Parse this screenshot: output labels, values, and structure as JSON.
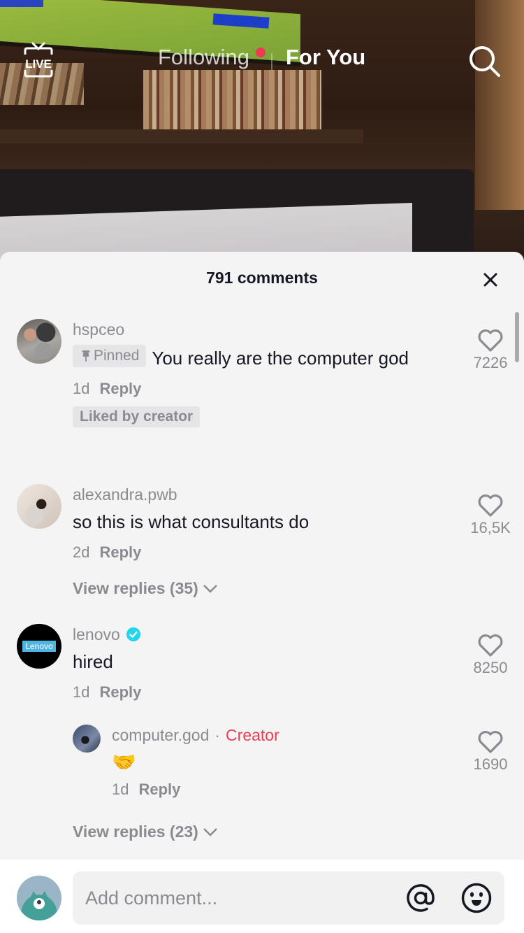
{
  "top_nav": {
    "live_label": "LIVE",
    "tabs": [
      {
        "label": "Following",
        "active": false,
        "has_notification_dot": true
      },
      {
        "label": "For You",
        "active": true
      }
    ],
    "icons": {
      "live": "live-tv-icon",
      "search": "search-icon"
    }
  },
  "comments_sheet": {
    "title": "791 comments",
    "close_icon": "close-icon",
    "comments": [
      {
        "username": "hspceo",
        "pinned_label": "Pinned",
        "text": "You really are the computer god",
        "time": "1d",
        "reply_label": "Reply",
        "liked_by_creator_label": "Liked by creator",
        "likes": "7226"
      },
      {
        "username": "alexandra.pwb",
        "text": "so this is what consultants do",
        "time": "2d",
        "reply_label": "Reply",
        "likes": "16,5K",
        "view_replies_label": "View replies (35)"
      },
      {
        "username": "lenovo",
        "verified": true,
        "avatar_text": "Lenovo",
        "text": "hired",
        "time": "1d",
        "reply_label": "Reply",
        "likes": "8250",
        "replies": [
          {
            "username": "computer.god",
            "separator": "·",
            "creator_label": "Creator",
            "text": "🤝",
            "time": "1d",
            "reply_label": "Reply",
            "likes": "1690"
          }
        ],
        "view_replies_label": "View replies (23)"
      }
    ]
  },
  "composer": {
    "placeholder": "Add comment...",
    "value": "",
    "icons": {
      "mention": "at-mention-icon",
      "emoji": "emoji-icon"
    }
  },
  "colors": {
    "accent": "#ee3b55",
    "verified": "#20d5ec",
    "sheet_bg": "#f4f4f4",
    "text_primary": "#161823",
    "text_secondary": "#8a8b91"
  }
}
